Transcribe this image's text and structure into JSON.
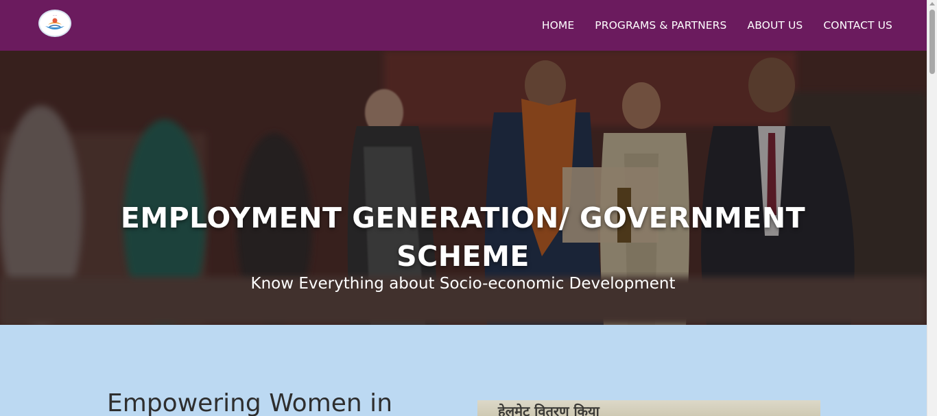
{
  "brand": {
    "logo_name": "organization-logo"
  },
  "nav": {
    "items": [
      {
        "label": "HOME"
      },
      {
        "label": "PROGRAMS & PARTNERS"
      },
      {
        "label": "ABOUT US"
      },
      {
        "label": "CONTACT US"
      }
    ]
  },
  "hero": {
    "title": "EMPLOYMENT GENERATION/ GOVERNMENT SCHEME",
    "subtitle": "Know Everything about Socio-economic Development"
  },
  "section": {
    "heading": "Empowering Women in",
    "image_caption": "हेलमेट वितरण किया"
  },
  "colors": {
    "navbar": "#6b1b5e",
    "section_bg": "#bcd9f2",
    "heading_text": "#2e2e2e"
  }
}
